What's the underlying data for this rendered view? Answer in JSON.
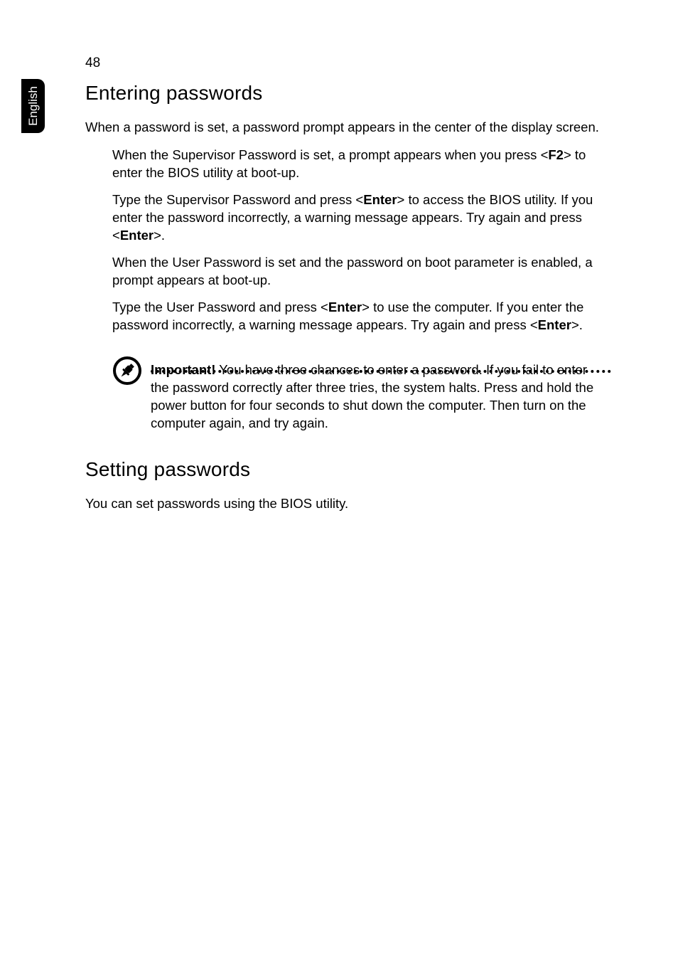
{
  "sideTab": {
    "label": "English"
  },
  "pageNumber": "48",
  "section1": {
    "heading": "Entering passwords",
    "intro": "When a password is set, a password prompt appears in the center of the display screen.",
    "bullet1_a": "When the Supervisor Password is set, a prompt appears when you press <",
    "bullet1_key": "F2",
    "bullet1_b": "> to enter the BIOS utility at boot-up.",
    "bullet2_a": "Type the Supervisor Password and press <",
    "bullet2_key1": "Enter",
    "bullet2_b": "> to access the BIOS utility. If you enter the password incorrectly, a warning message appears. Try again and press <",
    "bullet2_key2": "Enter",
    "bullet2_c": ">.",
    "bullet3": "When the User Password is set and the password on boot parameter is enabled, a prompt appears at boot-up.",
    "bullet4_a": "Type the User Password and press <",
    "bullet4_key1": "Enter",
    "bullet4_b": "> to use the computer. If you enter the password incorrectly, a warning message appears. Try again and press <",
    "bullet4_key2": "Enter",
    "bullet4_c": ">."
  },
  "note": {
    "label": "Important!",
    "text": " You have three chances to enter a password. If you fail to enter the password correctly after three tries, the system halts. Press and hold the power button for four seconds to shut down the computer. Then turn on the computer again, and try again."
  },
  "section2": {
    "heading": "Setting passwords",
    "body": "You can set passwords using the BIOS utility."
  }
}
